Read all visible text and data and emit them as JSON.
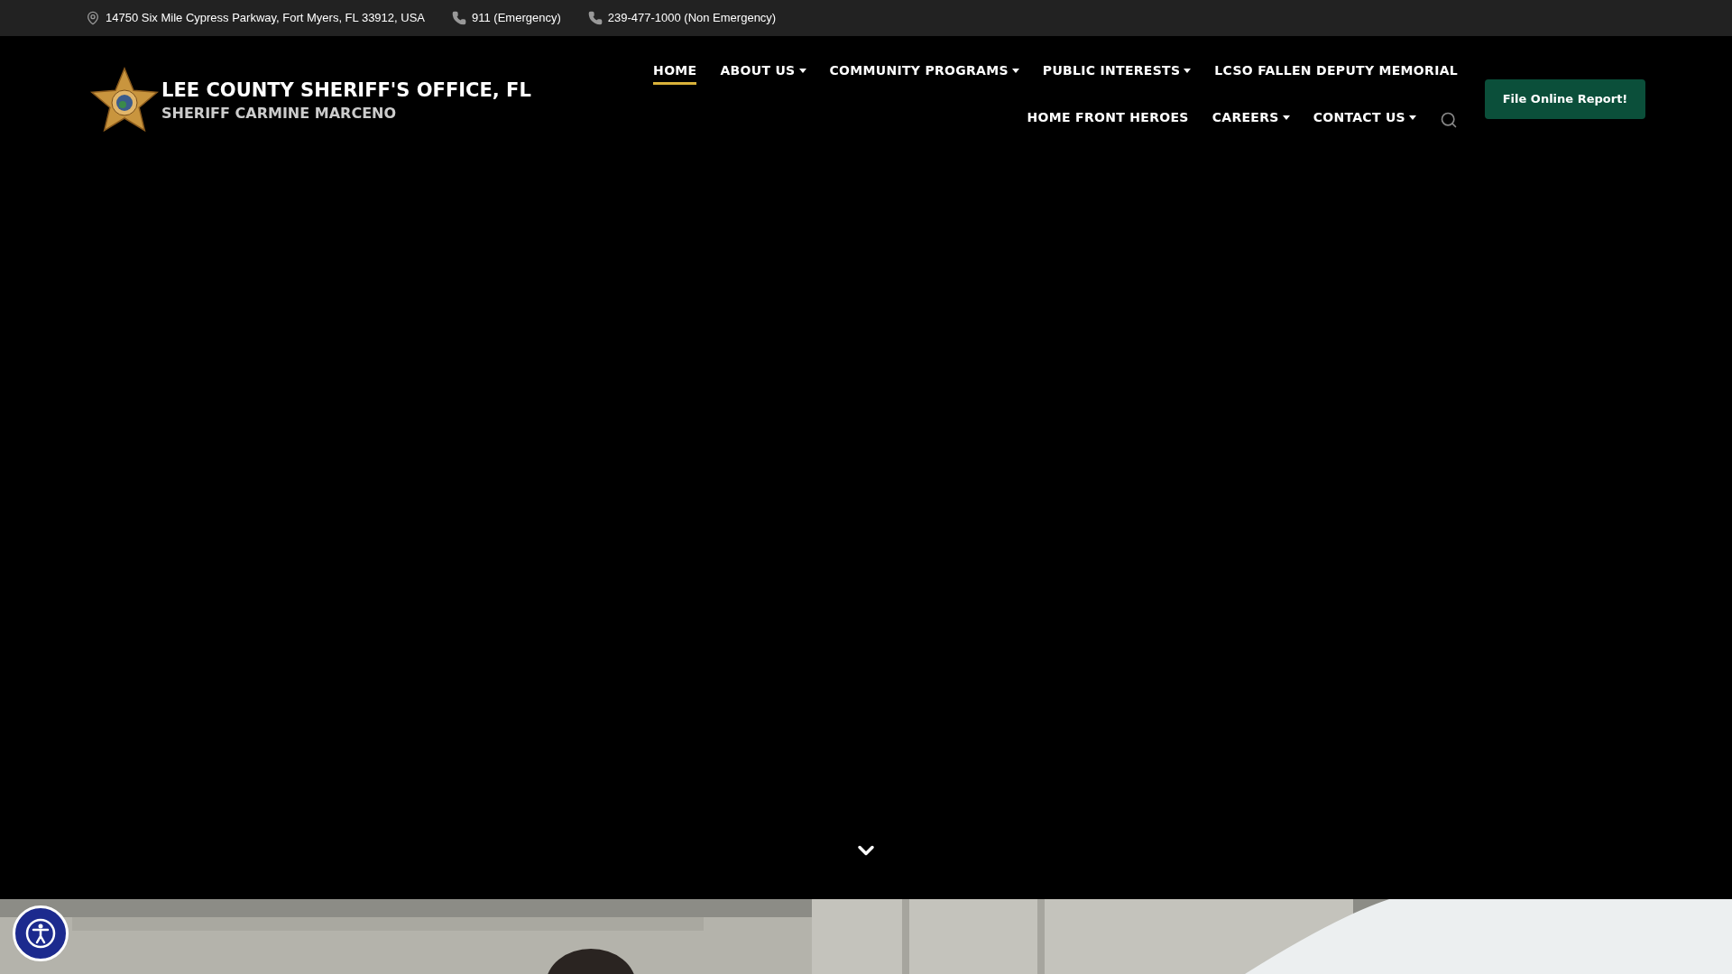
{
  "top_bar": {
    "items": [
      {
        "kind": "location",
        "text": "14750 Six Mile Cypress Parkway, Fort Myers, FL 33912, USA"
      },
      {
        "kind": "phone",
        "text": "911 (Emergency)"
      },
      {
        "kind": "phone",
        "text": "239-477-1000 (Non Emergency)"
      }
    ]
  },
  "brand": {
    "title": "LEE COUNTY SHERIFF'S OFFICE, FL",
    "subtitle": "SHERIFF CARMINE MARCENO"
  },
  "nav": {
    "items": [
      {
        "label": "HOME",
        "selected": true,
        "dropdown": false
      },
      {
        "label": "ABOUT US",
        "selected": false,
        "dropdown": true
      },
      {
        "label": "COMMUNITY PROGRAMS",
        "selected": false,
        "dropdown": true
      },
      {
        "label": "PUBLIC INTERESTS",
        "selected": false,
        "dropdown": true
      },
      {
        "label": "LCSO FALLEN DEPUTY MEMORIAL",
        "selected": false,
        "dropdown": false
      },
      {
        "label": "HOME FRONT HEROES",
        "selected": false,
        "dropdown": false
      },
      {
        "label": "CAREERS",
        "selected": false,
        "dropdown": true
      },
      {
        "label": "CONTACT US",
        "selected": false,
        "dropdown": true
      }
    ],
    "cta": "File Online Report!"
  }
}
